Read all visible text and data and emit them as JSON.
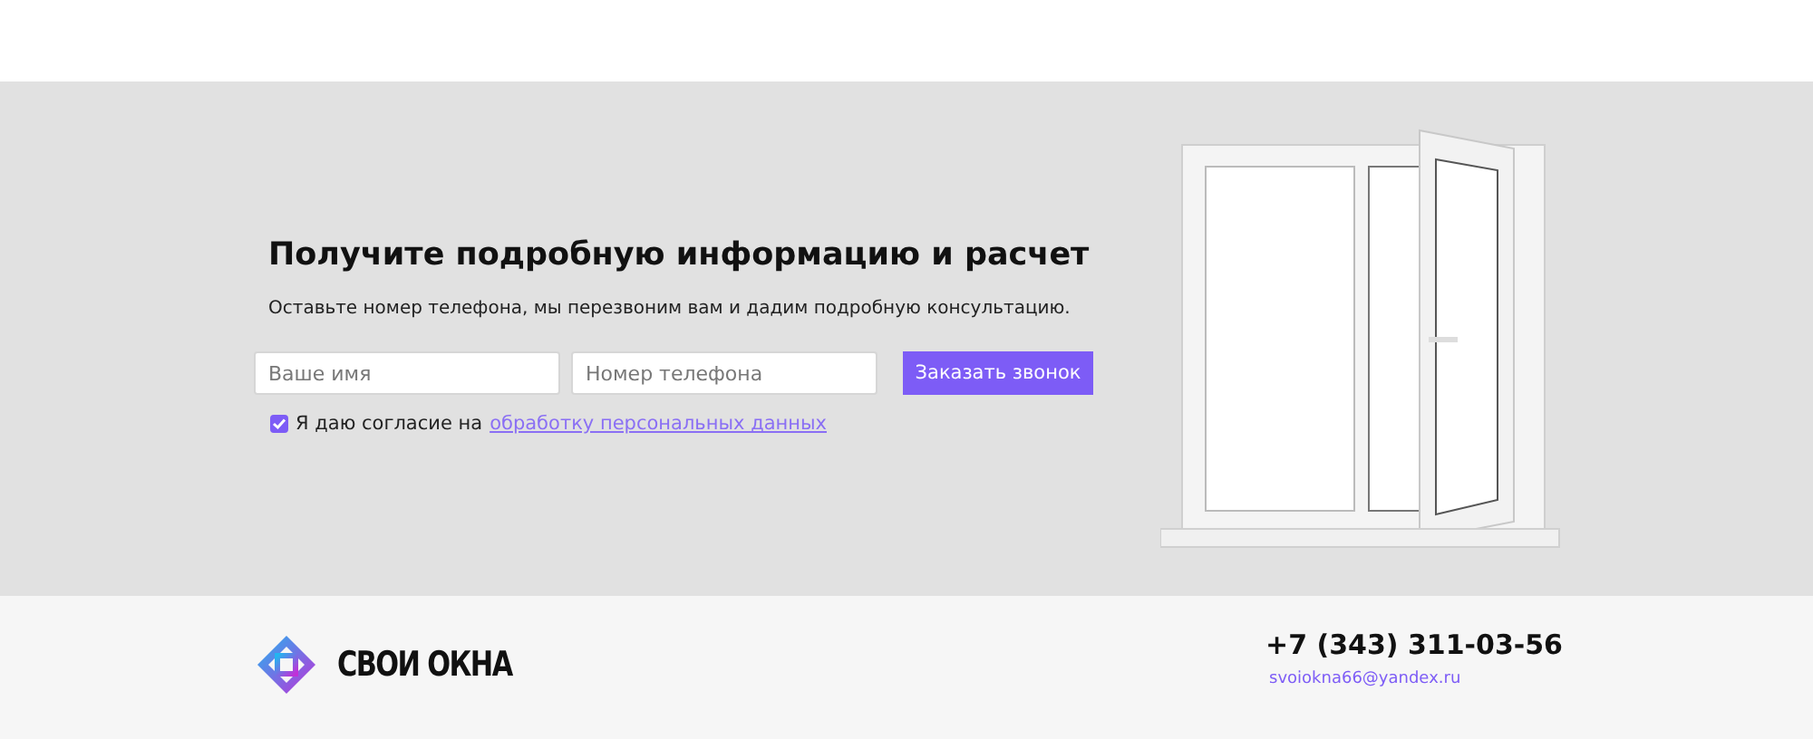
{
  "callback": {
    "title": "Получите подробную информацию и расчет",
    "subtitle": "Оставьте номер телефона, мы перезвоним вам и дадим подробную консультацию.",
    "name_field": {
      "placeholder": "Ваше имя"
    },
    "phone_field": {
      "placeholder": "Номер телефона"
    },
    "submit": "Заказать звонок",
    "consent": {
      "checked": true,
      "text": "Я даю согласие на",
      "link": "обработку персональных данных"
    }
  },
  "footer": {
    "logo": "СВОИ ОКНА",
    "phone": "+7 (343) 311-03-56",
    "email": "svoiokna66@yandex.ru"
  }
}
